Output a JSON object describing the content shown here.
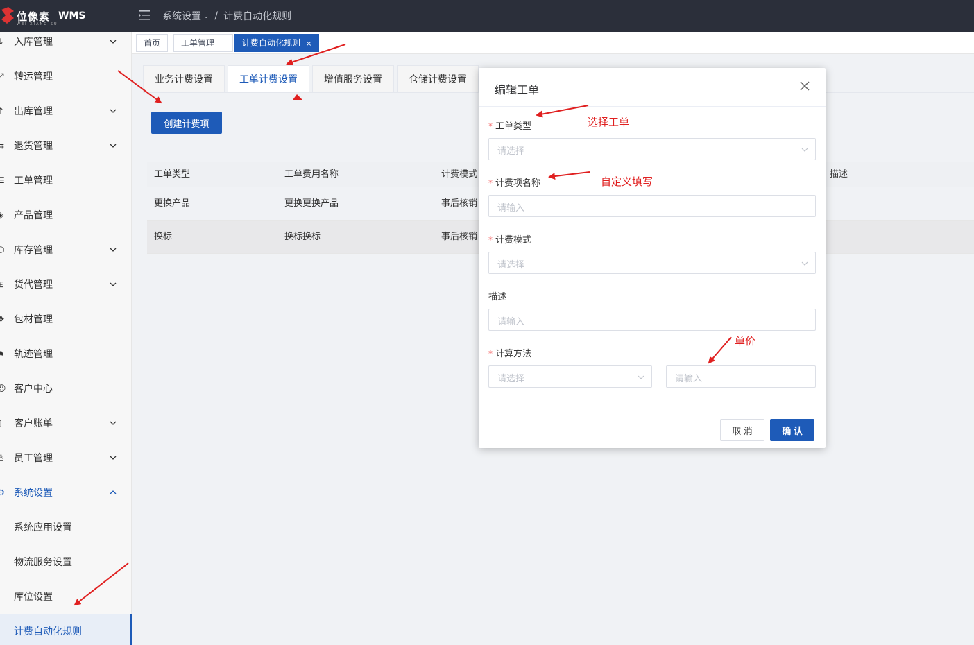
{
  "header": {
    "logo_text": "位像素",
    "logo_sub": "WEI XIANG SU",
    "logo_wms": "WMS",
    "breadcrumb": [
      "系统设置",
      "计费自动化规则"
    ]
  },
  "sidebar": {
    "items": [
      {
        "label": "入库管理",
        "icon": "inbound-icon",
        "has_chevron": true
      },
      {
        "label": "转运管理",
        "icon": "transfer-icon",
        "has_chevron": false
      },
      {
        "label": "出库管理",
        "icon": "outbound-icon",
        "has_chevron": true
      },
      {
        "label": "退货管理",
        "icon": "return-icon",
        "has_chevron": true
      },
      {
        "label": "工单管理",
        "icon": "workorder-icon",
        "has_chevron": false
      },
      {
        "label": "产品管理",
        "icon": "product-icon",
        "has_chevron": false
      },
      {
        "label": "库存管理",
        "icon": "inventory-icon",
        "has_chevron": true
      },
      {
        "label": "货代管理",
        "icon": "forwarder-icon",
        "has_chevron": true
      },
      {
        "label": "包材管理",
        "icon": "package-icon",
        "has_chevron": false
      },
      {
        "label": "轨迹管理",
        "icon": "track-icon",
        "has_chevron": false
      },
      {
        "label": "客户中心",
        "icon": "customer-icon",
        "has_chevron": false
      },
      {
        "label": "客户账单",
        "icon": "bill-icon",
        "has_chevron": true
      },
      {
        "label": "员工管理",
        "icon": "staff-icon",
        "has_chevron": true
      },
      {
        "label": "系统设置",
        "icon": "settings-icon",
        "has_chevron": true
      },
      {
        "label": "系统应用设置"
      },
      {
        "label": "物流服务设置"
      },
      {
        "label": "库位设置"
      },
      {
        "label": "计费自动化规则"
      }
    ]
  },
  "tags": [
    {
      "label": "首页"
    },
    {
      "label": "工单管理"
    },
    {
      "label": "计费自动化规则",
      "close": "×"
    }
  ],
  "tabs": [
    "业务计费设置",
    "工单计费设置",
    "增值服务设置",
    "仓储计费设置"
  ],
  "create_button": "创建计费项",
  "table": {
    "headers": [
      "工单类型",
      "工单费用名称",
      "计费模式",
      "描述"
    ],
    "rows": [
      [
        "更换产品",
        "更换更换产品",
        "事后核销",
        ""
      ],
      [
        "换标",
        "换标换标",
        "事后核销",
        ""
      ]
    ]
  },
  "modal": {
    "title": "编辑工单",
    "required_mark": "*",
    "fields": [
      {
        "label": "工单类型",
        "placeholder": "请选择"
      },
      {
        "label": "计费项名称",
        "placeholder": "请输入"
      },
      {
        "label": "计费模式",
        "placeholder": "请选择"
      },
      {
        "label": "描述",
        "placeholder": "请输入"
      },
      {
        "label": "计算方法",
        "placeholder": "请选择",
        "placeholder2": "请输入"
      }
    ],
    "cancel": "取 消",
    "confirm": "确 认"
  },
  "annotations": {
    "select_workorder": "选择工单",
    "custom_fill": "自定义填写",
    "unit_price": "单价"
  }
}
